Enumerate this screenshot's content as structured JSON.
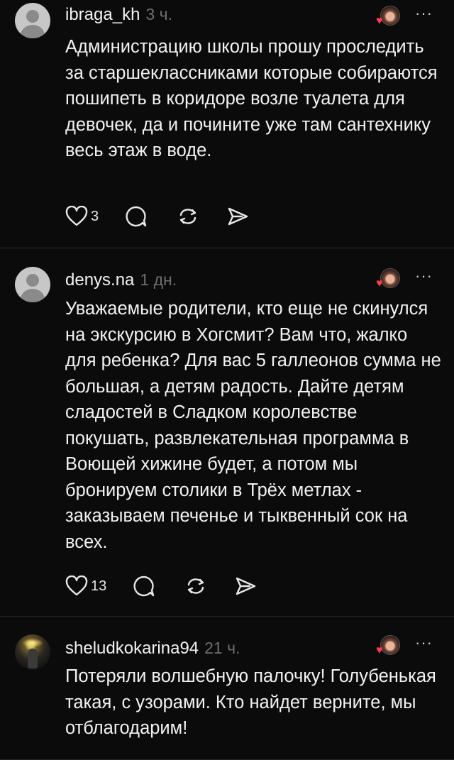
{
  "posts": [
    {
      "username": "ibraga_kh",
      "time": "3 ч.",
      "text": "Администрацию школы прошу проследить за старшеклассниками которые собираются пошипеть в коридоре возле туалета для девочек, да и почините уже там сантехнику весь этаж в воде.",
      "likes": "3",
      "avatar": "default"
    },
    {
      "username": "denys.na",
      "time": "1 дн.",
      "text": "Уважаемые родители, кто еще не скинулся на экскурсию в Хогсмит? Вам что, жалко для ребенка? Для вас 5 галлеонов сумма не большая, а детям радость. Дайте детям сладостей в Сладком королевстве покушать, развлекательная программа в Воющей хижине будет, а потом мы бронируем столики в Трёх метлах - заказываем печенье и тыквенный сок на всех.",
      "likes": "13",
      "avatar": "default"
    },
    {
      "username": "sheludkokarina94",
      "time": "21 ч.",
      "text": "Потеряли волшебную палочку! Голубенькая такая, с узорами. Кто найдет верните, мы отблагодарим!",
      "likes": "",
      "avatar": "photo"
    }
  ],
  "icons": {
    "like": "heart-icon",
    "comment": "comment-icon",
    "repost": "repost-icon",
    "share": "send-icon",
    "more": "more-icon"
  },
  "colors": {
    "background": "#0b0b0b",
    "text": "#f2f2f2",
    "muted": "#6e6e6e",
    "divider": "#262626",
    "heart": "#ff3b4e"
  }
}
